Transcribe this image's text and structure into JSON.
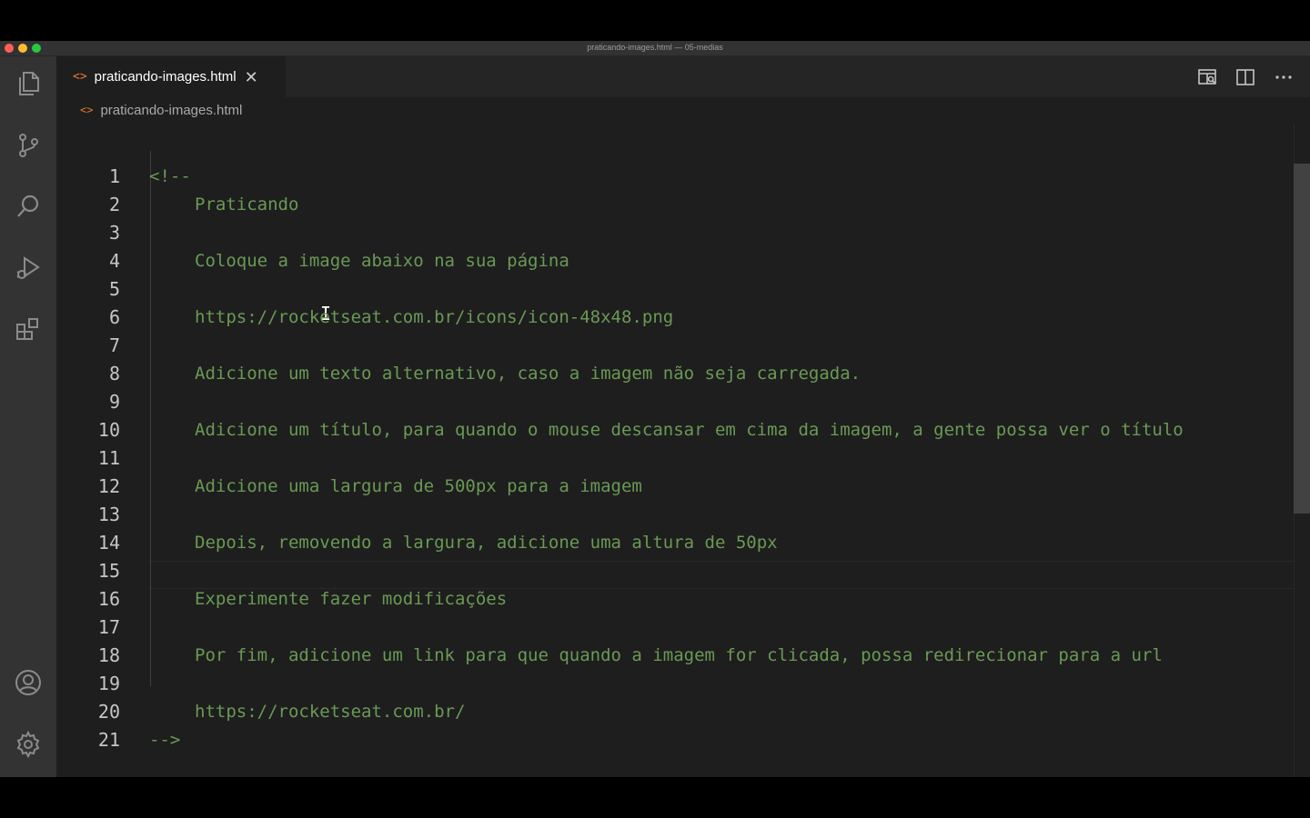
{
  "window": {
    "title": "praticando-images.html — 05-medias"
  },
  "activity_bar": {
    "items": [
      {
        "icon": "files-icon"
      },
      {
        "icon": "source-control-icon"
      },
      {
        "icon": "search-icon"
      },
      {
        "icon": "run-debug-icon"
      },
      {
        "icon": "extensions-icon"
      },
      {
        "icon": "account-icon"
      },
      {
        "icon": "gear-icon"
      }
    ]
  },
  "tabs": [
    {
      "label": "praticando-images.html",
      "icon_glyph": "<>",
      "close_glyph": "✕"
    }
  ],
  "breadcrumb": {
    "icon_glyph": "<>",
    "label": "praticando-images.html"
  },
  "editor": {
    "current_line": 17,
    "lines": [
      {
        "n": "1",
        "text": "<!--"
      },
      {
        "n": "2",
        "text": "Praticando"
      },
      {
        "n": "3",
        "text": ""
      },
      {
        "n": "4",
        "text": "Coloque a image abaixo na sua página"
      },
      {
        "n": "5",
        "text": ""
      },
      {
        "n": "6",
        "text": "https://rocketseat.com.br/icons/icon-48x48.png"
      },
      {
        "n": "7",
        "text": ""
      },
      {
        "n": "8",
        "text": "Adicione um texto alternativo, caso a imagem não seja carregada."
      },
      {
        "n": "9",
        "text": ""
      },
      {
        "n": "10",
        "text": "Adicione um título, para quando o mouse descansar em cima da imagem, a gente possa ver o título"
      },
      {
        "n": "11",
        "text": ""
      },
      {
        "n": "12",
        "text": "Adicione uma largura de 500px para a imagem"
      },
      {
        "n": "13",
        "text": ""
      },
      {
        "n": "14",
        "text": "Depois, removendo a largura, adicione uma altura de 50px"
      },
      {
        "n": "15",
        "text": ""
      },
      {
        "n": "16",
        "text": "Experimente fazer modificações"
      },
      {
        "n": "17",
        "text": ""
      },
      {
        "n": "18",
        "text": "Por fim, adicione um link para que quando a imagem for clicada, possa redirecionar para a url"
      },
      {
        "n": "19",
        "text": ""
      },
      {
        "n": "20",
        "text": "https://rocketseat.com.br/"
      },
      {
        "n": "21",
        "text": "-->"
      }
    ]
  },
  "colors": {
    "comment": "#6a9955",
    "editor_bg": "#1e1e1e",
    "activity_bar_bg": "#333333",
    "tab_icon": "#e37933"
  }
}
